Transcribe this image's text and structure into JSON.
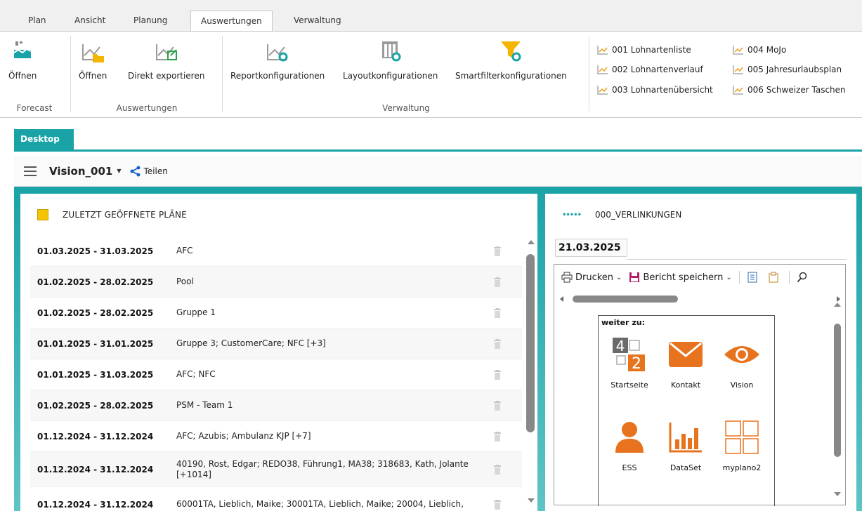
{
  "ribbon_tabs": [
    "Plan",
    "Ansicht",
    "Planung",
    "Auswertungen",
    "Verwaltung"
  ],
  "ribbon": {
    "forecast_open": "Öffnen",
    "forecast_group": "Forecast",
    "auswertungen_open": "Öffnen",
    "auswertungen_export": "Direkt exportieren",
    "auswertungen_group": "Auswertungen",
    "report_config": "Reportkonfigurationen",
    "layout_config": "Layoutkonfigurationen",
    "smartfilter_config": "Smartfilterkonfigurationen",
    "verwaltung_group": "Verwaltung",
    "reports": [
      "001 Lohnartenliste",
      "002 Lohnartenverlauf",
      "003 Lohnartenübersicht",
      "004 MoJo",
      "005 Jahresurlaubsplan",
      "006 Schweizer Taschen"
    ]
  },
  "desktop_tab": "Desktop",
  "toolbar": {
    "view_name": "Vision_001",
    "share_label": "Teilen"
  },
  "recent_plans": {
    "title": "ZULETZT GEÖFFNETE PLÄNE",
    "rows": [
      {
        "date": "01.03.2025 - 31.03.2025",
        "name": "AFC"
      },
      {
        "date": "01.02.2025 - 28.02.2025",
        "name": "Pool"
      },
      {
        "date": "01.02.2025 - 28.02.2025",
        "name": "Gruppe 1"
      },
      {
        "date": "01.01.2025 - 31.01.2025",
        "name": "Gruppe 3; CustomerCare; NFC [+3]"
      },
      {
        "date": "01.01.2025 - 31.03.2025",
        "name": "AFC; NFC"
      },
      {
        "date": "01.02.2025 - 28.02.2025",
        "name": "PSM - Team 1"
      },
      {
        "date": "01.12.2024 - 31.12.2024",
        "name": "AFC; Azubis; Ambulanz KJP [+7]"
      },
      {
        "date": "01.12.2024 - 31.12.2024",
        "name": "40190, Rost, Edgar; REDO38, Führung1, MA38; 318683, Kath, Jolante [+1014]"
      },
      {
        "date": "01.12.2024 - 31.12.2024",
        "name": "60001TA, Lieblich, Maike; 30001TA, Lieblich, Maike; 20004, Lieblich,"
      }
    ]
  },
  "links_panel": {
    "title": "000_VERLINKUNGEN",
    "date": "21.03.2025",
    "print_label": "Drucken",
    "save_label": "Bericht speichern",
    "weiter_label": "weiter zu:",
    "tiles": [
      "Startseite",
      "Kontakt",
      "Vision",
      "ESS",
      "DataSet",
      "myplano2"
    ]
  },
  "colors": {
    "accent": "#1aa3a7",
    "orange": "#e8731e",
    "yellow_icon": "#f5c400"
  }
}
